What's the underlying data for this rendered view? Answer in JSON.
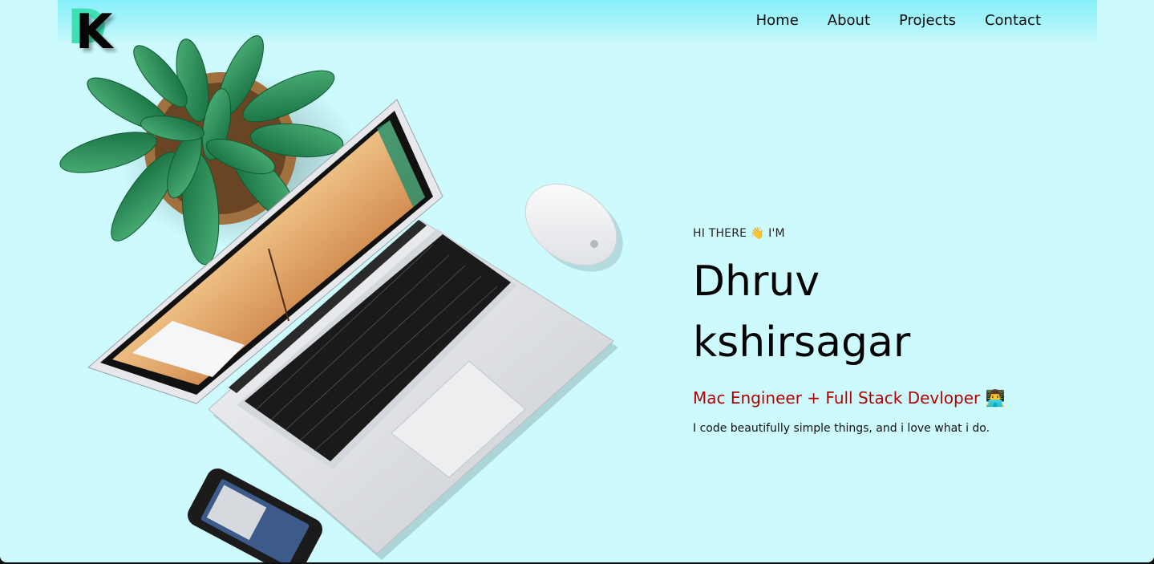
{
  "logo": {
    "back_letter": "D",
    "front_letter": "K"
  },
  "nav": {
    "items": [
      {
        "label": "Home"
      },
      {
        "label": "About"
      },
      {
        "label": "Projects"
      },
      {
        "label": "Contact"
      }
    ]
  },
  "hero": {
    "greeting": "HI THERE 👋 I'M",
    "name_line1": "Dhruv",
    "name_line2": "kshirsagar",
    "role": "Mac Engineer + Full Stack Devloper 👨‍💻",
    "tagline": "I code beautifully simple things, and i love what i do."
  },
  "colors": {
    "page_background": "#ccfafd",
    "nav_gradient_top": "#86eff9",
    "logo_accent": "#3fe0b4",
    "role_text": "#b30000"
  },
  "icons": [
    "plant-illustration",
    "laptop-illustration",
    "mouse-illustration",
    "phone-illustration"
  ]
}
